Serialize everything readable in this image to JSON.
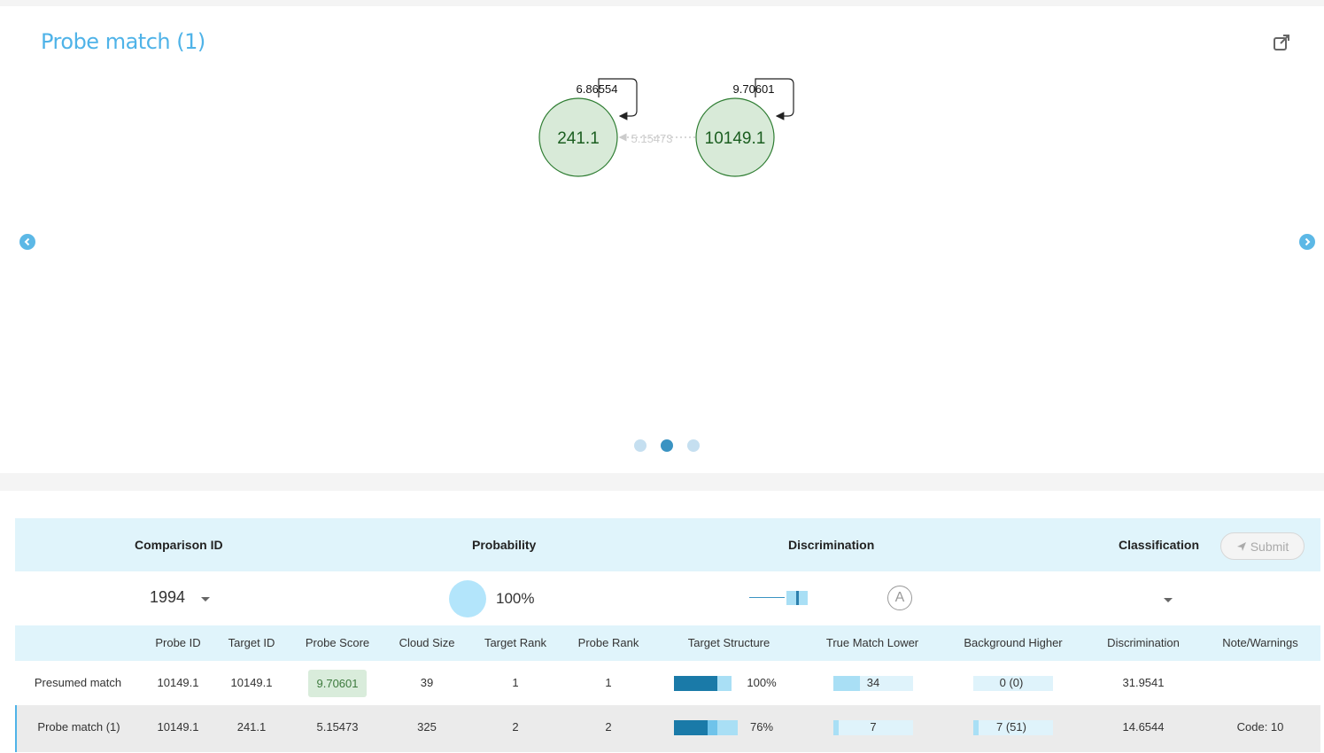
{
  "panel": {
    "title": "Probe match (1)",
    "external_icon": "external-link-icon",
    "prev_icon": "chevron-left-icon",
    "next_icon": "chevron-right-icon",
    "slides": 3,
    "active_slide": 2
  },
  "graph": {
    "nodes": [
      {
        "id": "241.1",
        "self_loop_label": "6.86554"
      },
      {
        "id": "10149.1",
        "self_loop_label": "9.70601"
      }
    ],
    "edge_label": "5.15473",
    "colors": {
      "node_fill": "#d8ead8",
      "node_stroke": "#2e7d32",
      "node_text": "#1b5e20"
    }
  },
  "summary": {
    "headers": {
      "comparison_id": "Comparison ID",
      "probability": "Probability",
      "discrimination": "Discrimination",
      "classification": "Classification"
    },
    "submit_label": "Submit",
    "comparison_value": "1994",
    "probability_value": "100%",
    "grade": "A"
  },
  "table": {
    "columns": [
      "Probe ID",
      "Target ID",
      "Probe Score",
      "Cloud Size",
      "Target Rank",
      "Probe Rank",
      "Target Structure",
      "True Match Lower",
      "Background Higher",
      "Discrimination",
      "Note/Warnings"
    ],
    "rows": [
      {
        "label": "Presumed match",
        "probe_id": "10149.1",
        "target_id": "10149.1",
        "probe_score": "9.70601",
        "cloud_size": "39",
        "target_rank": "1",
        "probe_rank": "1",
        "target_structure": "100%",
        "true_match_lower": "34",
        "background_higher": "0 (0)",
        "discrimination": "31.9541",
        "note": ""
      },
      {
        "label": "Probe match (1)",
        "probe_id": "10149.1",
        "target_id": "241.1",
        "probe_score": "5.15473",
        "cloud_size": "325",
        "target_rank": "2",
        "probe_rank": "2",
        "target_structure": "76%",
        "true_match_lower": "7",
        "background_higher": "7 (51)",
        "discrimination": "14.6544",
        "note": "Code: 10"
      }
    ]
  }
}
